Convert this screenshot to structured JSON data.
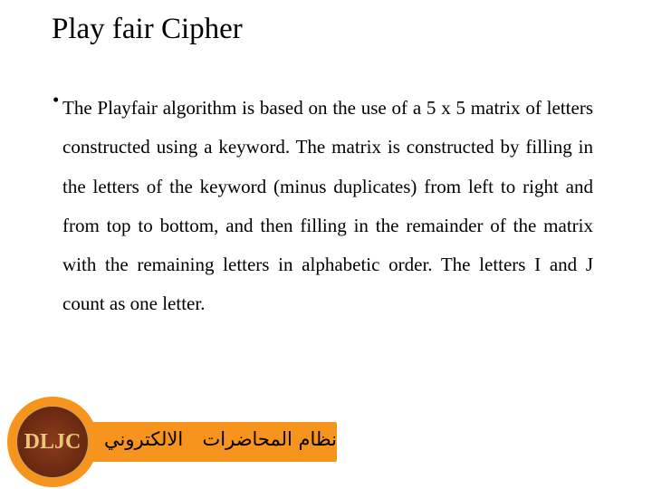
{
  "title": "Play fair Cipher",
  "bullet": "The Playfair algorithm is based on the use of a 5 x 5 matrix of letters constructed using a keyword. The matrix is constructed by filling in the letters of the keyword (minus duplicates) from left to right and from top to bottom, and then filling in the remainder of the matrix with the remaining letters in alphabetic order. The letters I and J count as one letter.",
  "footer": {
    "text_right": "نظام المحاضرات",
    "text_left": "الالكتروني",
    "logo_text": "DLJC",
    "accent": "#f7941d"
  }
}
